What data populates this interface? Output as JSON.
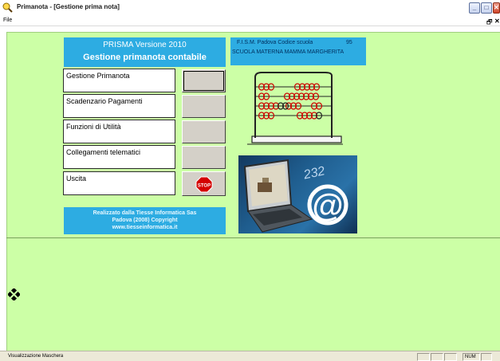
{
  "window": {
    "title": "Primanota - [Gestione prima nota]",
    "controls": {
      "minimize": "_",
      "maximize": "□",
      "close": "✕"
    }
  },
  "menubar": {
    "file": "File",
    "restore_child": "🗗",
    "close_child": "✕"
  },
  "header": {
    "line1": "PRISMA Versione 2010",
    "line2": "Gestione primanota contabile"
  },
  "school": {
    "line1": "F.I.S.M. Padova  Codice scuola",
    "code": "95",
    "line2": "SCUOLA MATERNA MAMMA MARGHERITA"
  },
  "menu_items": [
    {
      "label": "Gestione Primanota"
    },
    {
      "label": "Scadenzario Pagamenti"
    },
    {
      "label": "Funzioni di Utilità"
    },
    {
      "label": "Collegamenti telematici"
    },
    {
      "label": "Uscita"
    }
  ],
  "stop_label": "STOP",
  "credits": {
    "line1": "Realizzato dalla Tiesse Informatica Sas",
    "line2": "Padova (2008) Copyright",
    "line3": "www.tiesseinformatica.it"
  },
  "laptop_image": {
    "number_text": "232",
    "at_sign": "@"
  },
  "statusbar": {
    "text": "Visualizzazione Maschera",
    "num": "NUM"
  },
  "colors": {
    "form_background": "#ccffa6",
    "accent_blue": "#2dace2",
    "stop_red": "#d40000"
  }
}
